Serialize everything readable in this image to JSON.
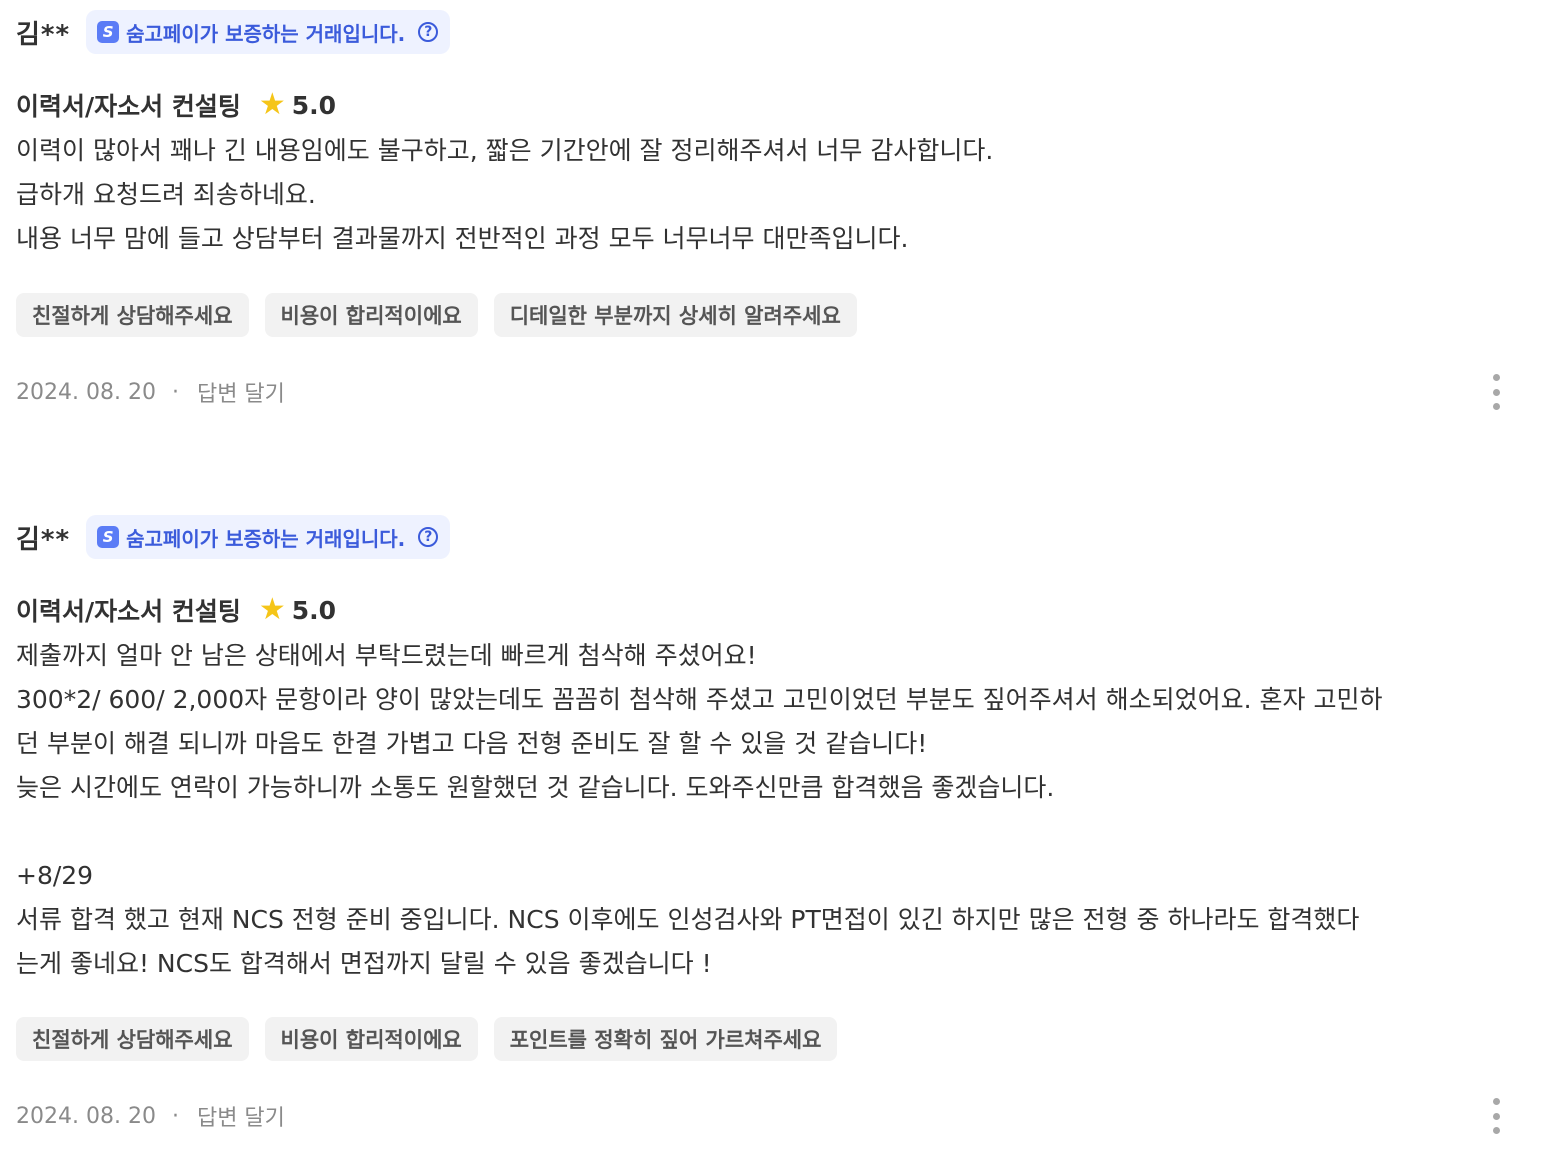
{
  "reviews": [
    {
      "author": "김**",
      "pay_badge": {
        "logo": "S",
        "text": "숨고페이가 보증하는 거래입니다.",
        "help": "?"
      },
      "service": "이력서/자소서 컨설팅",
      "star_icon": "star-icon",
      "rating": "5.0",
      "lines": [
        "이력이 많아서 꽤나 긴 내용임에도 불구하고, 짧은 기간안에 잘 정리해주셔서 너무 감사합니다.",
        "급하개 요청드려 죄송하네요.",
        "내용 너무 맘에 들고 상담부터 결과물까지 전반적인 과정 모두 너무너무 대만족입니다."
      ],
      "chips": [
        "친절하게 상담해주세요",
        "비용이 합리적이에요",
        "디테일한 부분까지 상세히 알려주세요"
      ],
      "date": "2024. 08. 20",
      "separator": "·",
      "reply": "답변 달기"
    },
    {
      "author": "김**",
      "pay_badge": {
        "logo": "S",
        "text": "숨고페이가 보증하는 거래입니다.",
        "help": "?"
      },
      "service": "이력서/자소서 컨설팅",
      "star_icon": "star-icon",
      "rating": "5.0",
      "lines": [
        "제출까지 얼마 안 남은 상태에서 부탁드렸는데 빠르게 첨삭해 주셨어요!",
        "300*2/ 600/ 2,000자 문항이라 양이 많았는데도 꼼꼼히 첨삭해 주셨고 고민이었던 부분도 짚어주셔서 해소되었어요. 혼자 고민하",
        "던 부분이 해결 되니까 마음도 한결 가볍고 다음 전형 준비도 잘 할 수 있을 것 같습니다!",
        "늦은 시간에도 연락이 가능하니까 소통도 원할했던 것 같습니다. 도와주신만큼 합격했음 좋겠습니다.",
        "",
        "+8/29",
        "서류 합격 했고 현재 NCS 전형 준비 중입니다. NCS 이후에도 인성검사와 PT면접이 있긴 하지만 많은 전형 중 하나라도 합격했다",
        "는게 좋네요! NCS도 합격해서 면접까지 달릴 수 있음 좋겠습니다 !"
      ],
      "chips": [
        "친절하게 상담해주세요",
        "비용이 합리적이에요",
        "포인트를 정확히 짚어 가르쳐주세요"
      ],
      "date": "2024. 08. 20",
      "separator": "·",
      "reply": "답변 달기"
    }
  ],
  "colors": {
    "text": "#323232",
    "badge_bg": "#eef2ff",
    "badge_text": "#3b5bdb",
    "star": "#f5c518",
    "chip_bg": "#f2f2f2",
    "muted": "#8a8a8a"
  }
}
